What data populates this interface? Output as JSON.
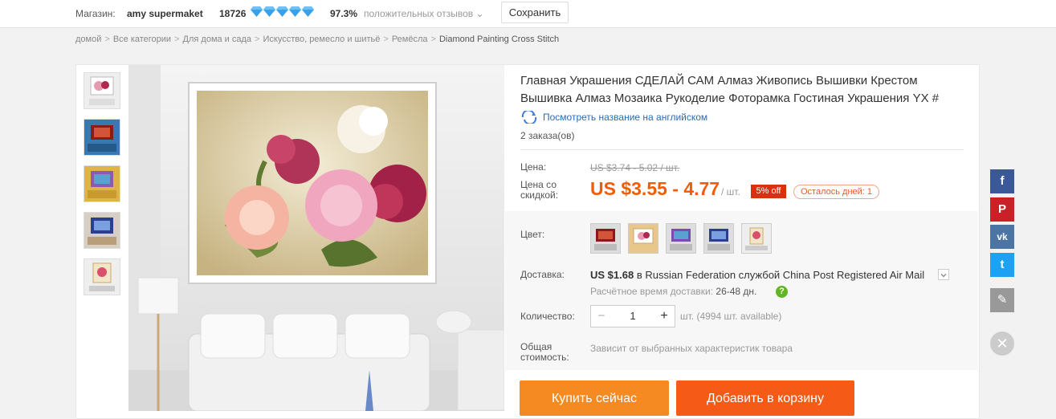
{
  "store_bar": {
    "store_label": "Магазин:",
    "store_name": "amy supermaket",
    "score": "18726",
    "positive_pct": "97.3%",
    "feedback_label": "положительных отзывов ⌄",
    "save_button": "Сохранить"
  },
  "breadcrumb": {
    "items": [
      "домой",
      "Все категории",
      "Для дома и сада",
      "Искусство, ремесло и шитьё",
      "Ремёсла",
      "Diamond Painting Cross Stitch"
    ],
    "separator": ">"
  },
  "product": {
    "title": "Главная Украшения СДЕЛАЙ САМ Алмаз Живопись Вышивки Крестом Вышивка Алмаз Мозаика Рукоделие Фоторамка Гостиная Украшения YX #",
    "translate_link": "Посмотреть название на английском",
    "orders": "2 заказа(ов)"
  },
  "price": {
    "price_label": "Цена:",
    "original_price": "US $3.74 - 5.02 / шт.",
    "discount_label_line1": "Цена со",
    "discount_label_line2": "скидкой:",
    "sale_price": "US $3.55 - 4.77",
    "per_unit": "/ шт.",
    "off_badge": "5% off",
    "days_left": "Осталось дней: 1",
    "accent_color": "#f25c05"
  },
  "options": {
    "color_label": "Цвет:",
    "shipping_label": "Доставка:",
    "shipping_price": "US $1.68",
    "shipping_to": " в Russian Federation службой China Post Registered Air Mail",
    "eta_label": "Расчётное время доставки:",
    "eta_value": "26-48 дн.",
    "help": "?",
    "quantity_label": "Количество:",
    "quantity_minus": "−",
    "quantity_value": "1",
    "quantity_plus": "+",
    "availability": "шт. (4994 шт. available)",
    "total_label_line1": "Общая",
    "total_label_line2": "стоимость:",
    "total_value": "Зависит от выбранных характеристик товара"
  },
  "actions": {
    "buy_now": "Купить сейчас",
    "add_to_cart": "Добавить в корзину"
  },
  "share": {
    "facebook": "f",
    "pinterest": "P",
    "vk": "vk",
    "twitter": "t",
    "edit": "✎",
    "close": "✕"
  }
}
